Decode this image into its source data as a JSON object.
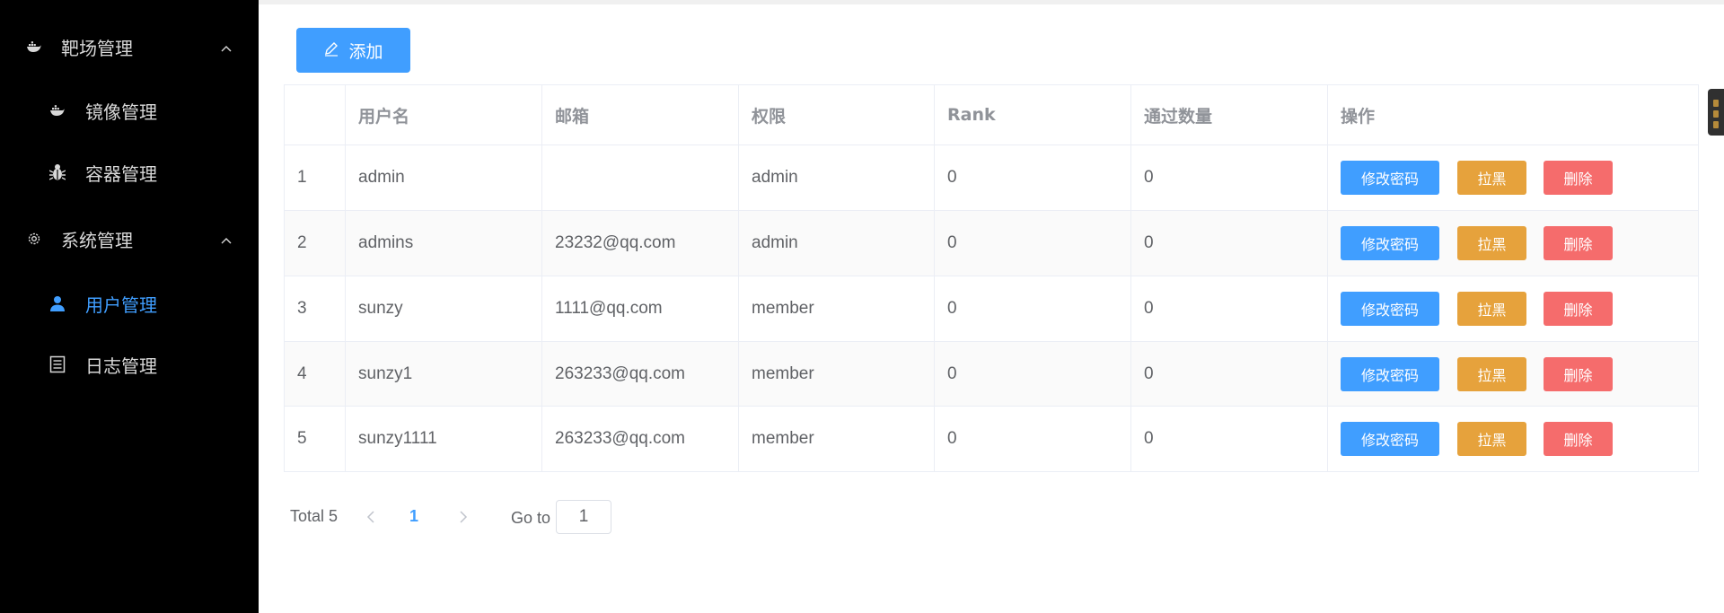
{
  "sidebar": {
    "groups": [
      {
        "label": "靶场管理",
        "icon": "docker-icon",
        "items": [
          {
            "label": "镜像管理",
            "icon": "docker-icon"
          },
          {
            "label": "容器管理",
            "icon": "bug-icon"
          }
        ]
      },
      {
        "label": "系统管理",
        "icon": "gear-icon",
        "items": [
          {
            "label": "用户管理",
            "icon": "user-icon",
            "active": true
          },
          {
            "label": "日志管理",
            "icon": "document-icon"
          }
        ]
      }
    ]
  },
  "toolbar": {
    "add_label": "添加",
    "add_icon": "edit-icon"
  },
  "table": {
    "columns": [
      "",
      "用户名",
      "邮箱",
      "权限",
      "Rank",
      "通过数量",
      "操作"
    ],
    "rows": [
      {
        "index": "1",
        "username": "admin",
        "email": "",
        "role": "admin",
        "rank": "0",
        "passed": "0"
      },
      {
        "index": "2",
        "username": "admins",
        "email": "23232@qq.com",
        "role": "admin",
        "rank": "0",
        "passed": "0"
      },
      {
        "index": "3",
        "username": "sunzy",
        "email": "1111@qq.com",
        "role": "member",
        "rank": "0",
        "passed": "0"
      },
      {
        "index": "4",
        "username": "sunzy1",
        "email": "263233@qq.com",
        "role": "member",
        "rank": "0",
        "passed": "0"
      },
      {
        "index": "5",
        "username": "sunzy1111",
        "email": "263233@qq.com",
        "role": "member",
        "rank": "0",
        "passed": "0"
      }
    ],
    "actions": {
      "edit_password": "修改密码",
      "blacklist": "拉黑",
      "delete": "删除"
    }
  },
  "pagination": {
    "total": "Total 5",
    "current_page": "1",
    "goto_label": "Go to",
    "goto_value": "1"
  },
  "colors": {
    "primary": "#409eff",
    "warning": "#e6a23c",
    "danger": "#f56c6c",
    "sidebar_bg": "#000000"
  }
}
